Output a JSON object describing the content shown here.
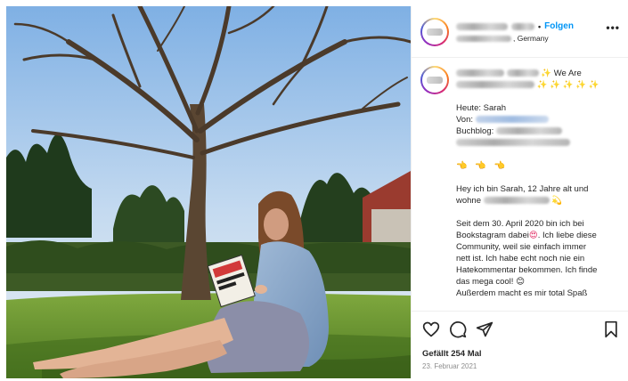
{
  "post": {
    "username_hidden": true,
    "follow_label": "Folgen",
    "location_suffix": ", Germany",
    "more_label": "•••"
  },
  "caption": {
    "title_suffix": "✨ We Are",
    "sparkles": "✨ ✨ ✨ ✨ ✨",
    "today_label": "Heute: Sarah",
    "from_label": "Von:",
    "blog_label": "Buchblog:",
    "pointing_emojis": "👈 👈 👈",
    "intro_line1": "Hey ich bin Sarah, 12 Jahre alt und",
    "intro_line2": "wohne",
    "intro_emoji": "💫",
    "paragraph": [
      "Seit dem 30. April 2020 bin ich bei",
      "Bookstagram dabei",
      ". Ich liebe diese",
      "Community, weil sie einfach immer",
      "nett ist. Ich habe echt noch nie ein",
      "Hatekommentar bekommen. Ich finde",
      "das mega cool!",
      "Außerdem macht es mir total Spaß"
    ],
    "heart_emoji": "😍",
    "smile_emoji": "😊"
  },
  "actions": {
    "like_icon": "heart-icon",
    "comment_icon": "comment-icon",
    "share_icon": "send-icon",
    "save_icon": "bookmark-icon",
    "likes_text": "Gefällt 254 Mal",
    "date_text": "23. Februar 2021"
  },
  "colors": {
    "follow_blue": "#0095f6",
    "text": "#262626",
    "muted": "#8e8e8e",
    "border": "#efefef"
  }
}
